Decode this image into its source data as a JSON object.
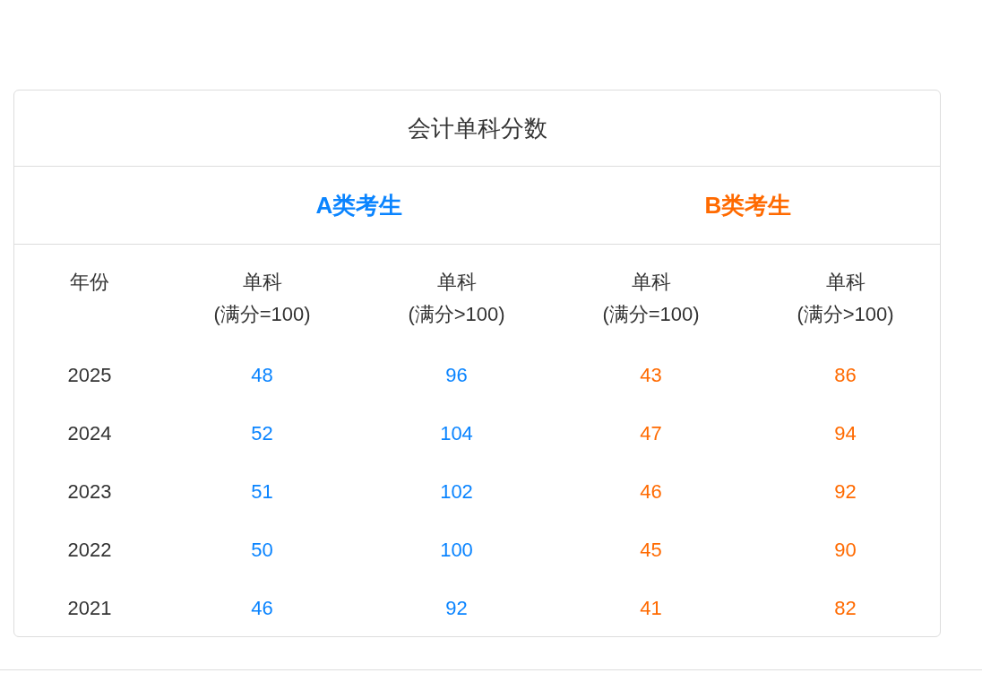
{
  "title": "会计单科分数",
  "groups": [
    {
      "label": "A类考生",
      "color": "#0a84ff",
      "columns": [
        {
          "title": "单科",
          "subtitle": "(满分=100)"
        },
        {
          "title": "单科",
          "subtitle": "(满分>100)"
        }
      ]
    },
    {
      "label": "B类考生",
      "color": "#ff6a00",
      "columns": [
        {
          "title": "单科",
          "subtitle": "(满分=100)"
        },
        {
          "title": "单科",
          "subtitle": "(满分>100)"
        }
      ]
    }
  ],
  "year_heading": "年份",
  "rows": [
    {
      "year": "2025",
      "values": [
        "48",
        "96",
        "43",
        "86"
      ]
    },
    {
      "year": "2024",
      "values": [
        "52",
        "104",
        "47",
        "94"
      ]
    },
    {
      "year": "2023",
      "values": [
        "51",
        "102",
        "46",
        "92"
      ]
    },
    {
      "year": "2022",
      "values": [
        "50",
        "100",
        "45",
        "90"
      ]
    },
    {
      "year": "2021",
      "values": [
        "46",
        "92",
        "41",
        "82"
      ]
    }
  ]
}
